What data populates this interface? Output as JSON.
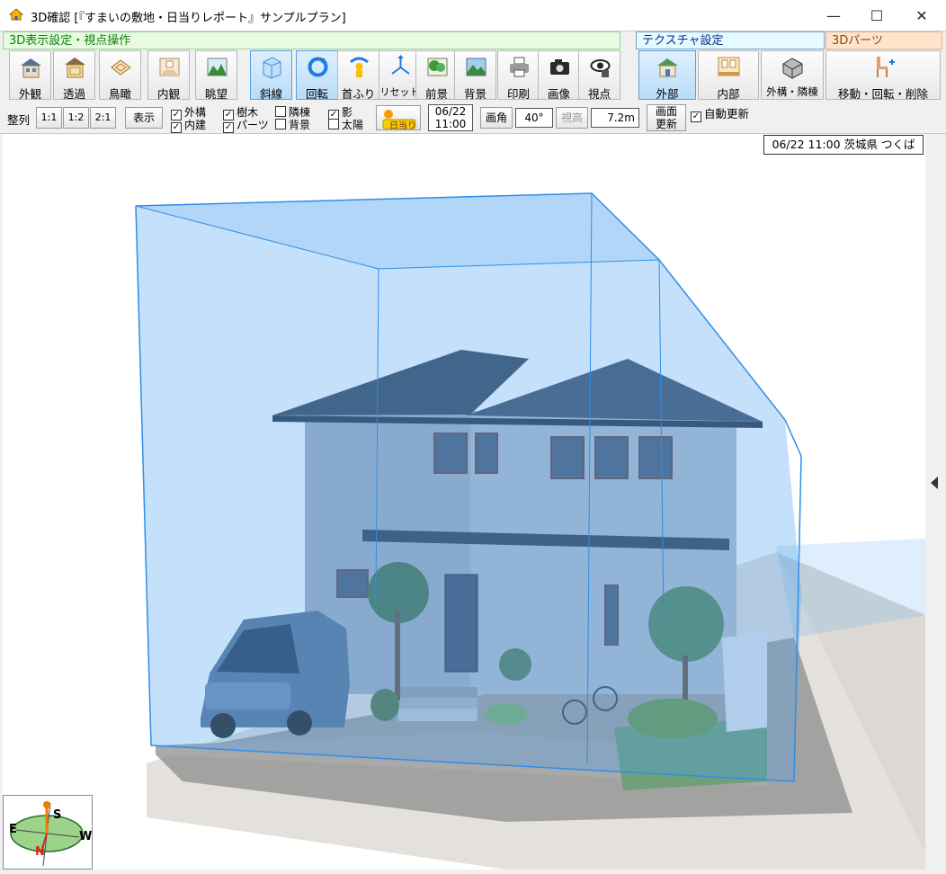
{
  "window": {
    "title": "3D確認 [『すまいの敷地・日当りレポート』サンプルプラン]",
    "minimize": "—",
    "maximize": "☐",
    "close": "✕"
  },
  "sections": {
    "view_ops": "3D表示設定・視点操作",
    "texture": "テクスチャ設定",
    "parts": "3Dパーツ"
  },
  "toolbar": {
    "view_buttons": [
      {
        "label": "外観",
        "icon": "house-exterior-icon"
      },
      {
        "label": "透過",
        "icon": "house-transparent-icon"
      },
      {
        "label": "鳥瞰",
        "icon": "birds-eye-icon"
      },
      {
        "label": "内観",
        "icon": "interior-icon"
      },
      {
        "label": "眺望",
        "icon": "landscape-icon"
      }
    ],
    "oblique": {
      "label": "斜線",
      "icon": "oblique-line-icon"
    },
    "ops_buttons": [
      {
        "label": "回転",
        "icon": "rotate-icon"
      },
      {
        "label": "首ふり",
        "icon": "pan-head-icon"
      },
      {
        "label": "リセット",
        "icon": "reset-icon"
      }
    ],
    "scene_buttons": [
      {
        "label": "前景",
        "icon": "foreground-icon"
      },
      {
        "label": "背景",
        "icon": "background-icon"
      }
    ],
    "output_buttons": [
      {
        "label": "印刷",
        "icon": "printer-icon"
      },
      {
        "label": "画像",
        "icon": "camera-icon"
      },
      {
        "label": "視点",
        "icon": "viewpoint-eye-icon"
      }
    ],
    "texture_buttons": [
      {
        "label": "外部",
        "icon": "exterior-texture-icon"
      },
      {
        "label": "内部",
        "icon": "interior-texture-icon"
      },
      {
        "label": "外構・隣棟",
        "icon": "exterior-structure-icon"
      }
    ],
    "parts_button": {
      "label": "移動・回転・削除",
      "icon": "chair-move-icon"
    }
  },
  "toolbar2": {
    "align_label": "整列",
    "ratio1": "1:1",
    "ratio2": "1:2",
    "ratio3": "2:1",
    "display_button": "表示",
    "checks": [
      {
        "label": "外構",
        "checked": true
      },
      {
        "label": "内建",
        "checked": true
      },
      {
        "label": "樹木",
        "checked": true
      },
      {
        "label": "パーツ",
        "checked": true
      },
      {
        "label": "隣棟",
        "checked": false
      },
      {
        "label": "背景",
        "checked": false
      },
      {
        "label": "影",
        "checked": true
      },
      {
        "label": "太陽",
        "checked": false
      }
    ],
    "sun_button": "日当り",
    "date": "06/22",
    "time": "11:00",
    "angle_label": "画角",
    "angle_value": "40°",
    "eye_height_label": "視高",
    "eye_height_value": "7.2m",
    "refresh_top": "画面",
    "refresh_bottom": "更新",
    "auto_refresh": {
      "label": "自動更新",
      "checked": true
    }
  },
  "viewport": {
    "date_location": "06/22 11:00 茨城県 つくば"
  },
  "compass": {
    "north": "N",
    "south": "S",
    "east": "E",
    "west": "W"
  },
  "colors": {
    "section_green_bg": "#e8fbe0",
    "volume_blue": "#4a9ff0",
    "active_button": "#b8dcf8"
  }
}
